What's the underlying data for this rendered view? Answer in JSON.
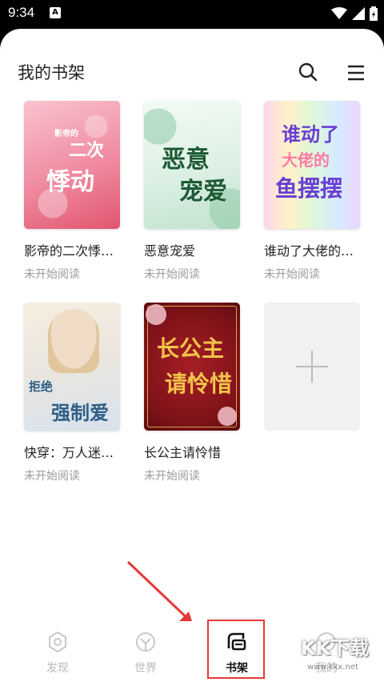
{
  "status_bar": {
    "time": "9:34",
    "notification_letter": "A"
  },
  "header": {
    "title": "我的书架",
    "search_icon": "search-icon",
    "menu_icon": "menu-icon"
  },
  "books": [
    {
      "title": "影帝的二次悸…",
      "status": "未开始阅读",
      "cover_text": [
        "影帝的",
        "二次",
        "悸动"
      ],
      "cover_colors": [
        "#f7b6c2",
        "#e8506a"
      ]
    },
    {
      "title": "恶意宠爱",
      "status": "未开始阅读",
      "cover_text": [
        "恶意",
        "宠爱"
      ],
      "cover_colors": [
        "#dff2e8",
        "#9fcfb0"
      ]
    },
    {
      "title": "谁动了大佬的…",
      "status": "未开始阅读",
      "cover_text": [
        "谁动了",
        "大佬的",
        "鱼摆摆"
      ],
      "cover_colors": [
        "#f3d7f1",
        "#cfe6ff"
      ]
    },
    {
      "title": "快穿：万人迷…",
      "status": "未开始阅读",
      "cover_text": [
        "拒绝",
        "强制爱"
      ],
      "cover_colors": [
        "#f4efe4",
        "#dfe6ef"
      ]
    },
    {
      "title": "长公主请怜惜",
      "status": "未开始阅读",
      "cover_text": [
        "长公主",
        "请怜惜"
      ],
      "cover_colors": [
        "#8e1a1f",
        "#5a0c10"
      ]
    }
  ],
  "tabs": [
    {
      "label": "发现",
      "icon": "discover-icon",
      "active": false
    },
    {
      "label": "世界",
      "icon": "world-icon",
      "active": false
    },
    {
      "label": "书架",
      "icon": "bookshelf-icon",
      "active": true
    },
    {
      "label": "我的",
      "icon": "profile-icon",
      "active": false
    }
  ],
  "colors": {
    "accent": "#e53935",
    "muted_text": "#9a9a9a",
    "tab_inactive": "#b9b9b9"
  },
  "watermark": "KK下载",
  "watermark_url": "www.kkx.net"
}
